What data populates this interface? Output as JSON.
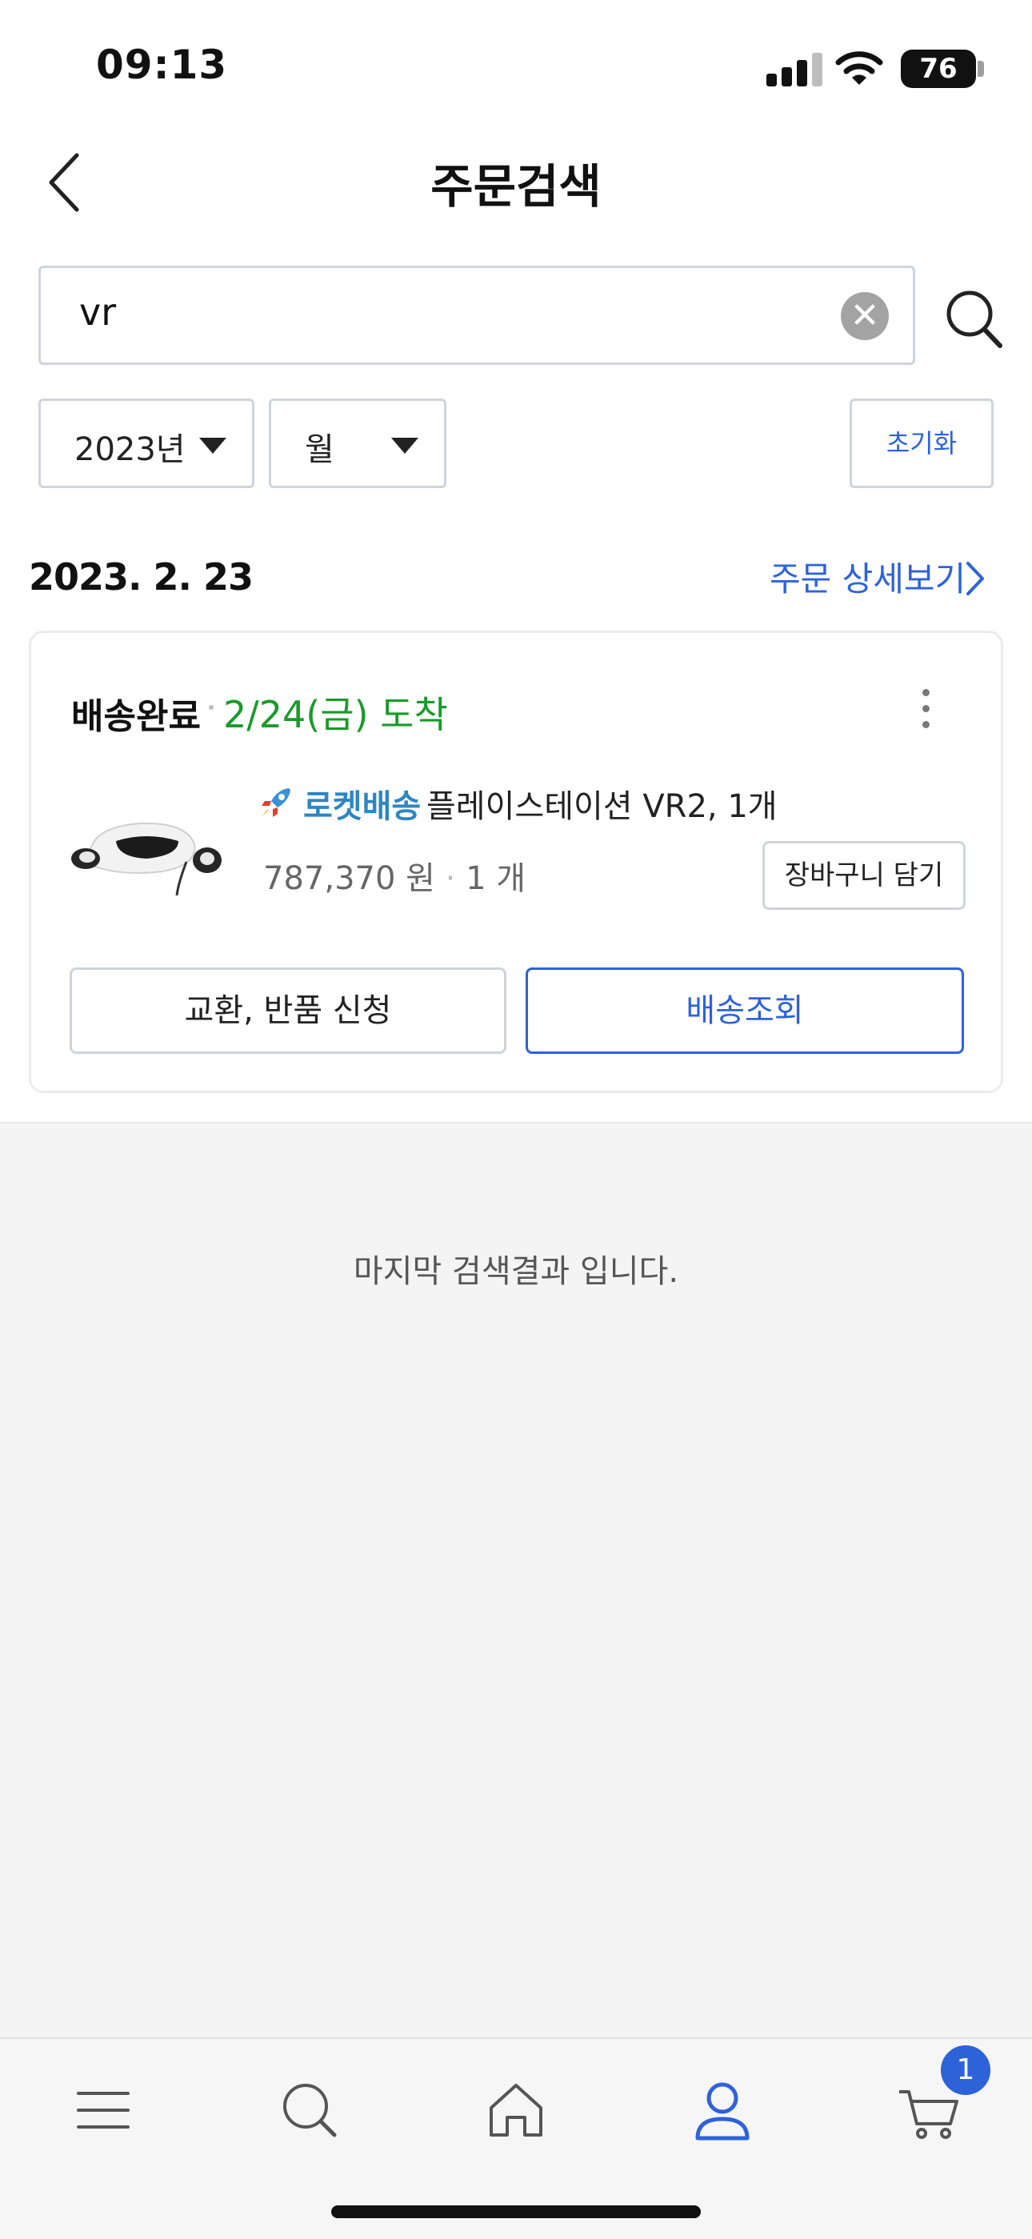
{
  "status_bar": {
    "time": "09:13",
    "battery": "76"
  },
  "header": {
    "title": "주문검색"
  },
  "search": {
    "value": "vr",
    "clear_glyph": "✕"
  },
  "filters": {
    "year": "2023년",
    "month": "월",
    "reset_label": "초기화"
  },
  "order": {
    "date": "2023. 2. 23",
    "detail_link": "주문 상세보기",
    "status": "배송완료",
    "arrival": "2/24(금) 도착",
    "delivery_type": "로켓배송",
    "product_name": "플레이스테이션 VR2, 1개",
    "price": "787,370 원",
    "quantity": "1 개",
    "add_to_cart_label": "장바구니 담기",
    "exchange_label": "교환, 반품 신청",
    "track_label": "배송조회"
  },
  "end_message": "마지막 검색결과 입니다.",
  "tab_bar": {
    "items": [
      "menu-icon",
      "search-icon",
      "home-icon",
      "user-icon",
      "cart-icon"
    ],
    "active": "user-icon",
    "cart_badge": "1"
  },
  "colors": {
    "accent": "#2e62d9",
    "arrival_green": "#199a2b",
    "rocket_blue": "#2e86c1"
  }
}
